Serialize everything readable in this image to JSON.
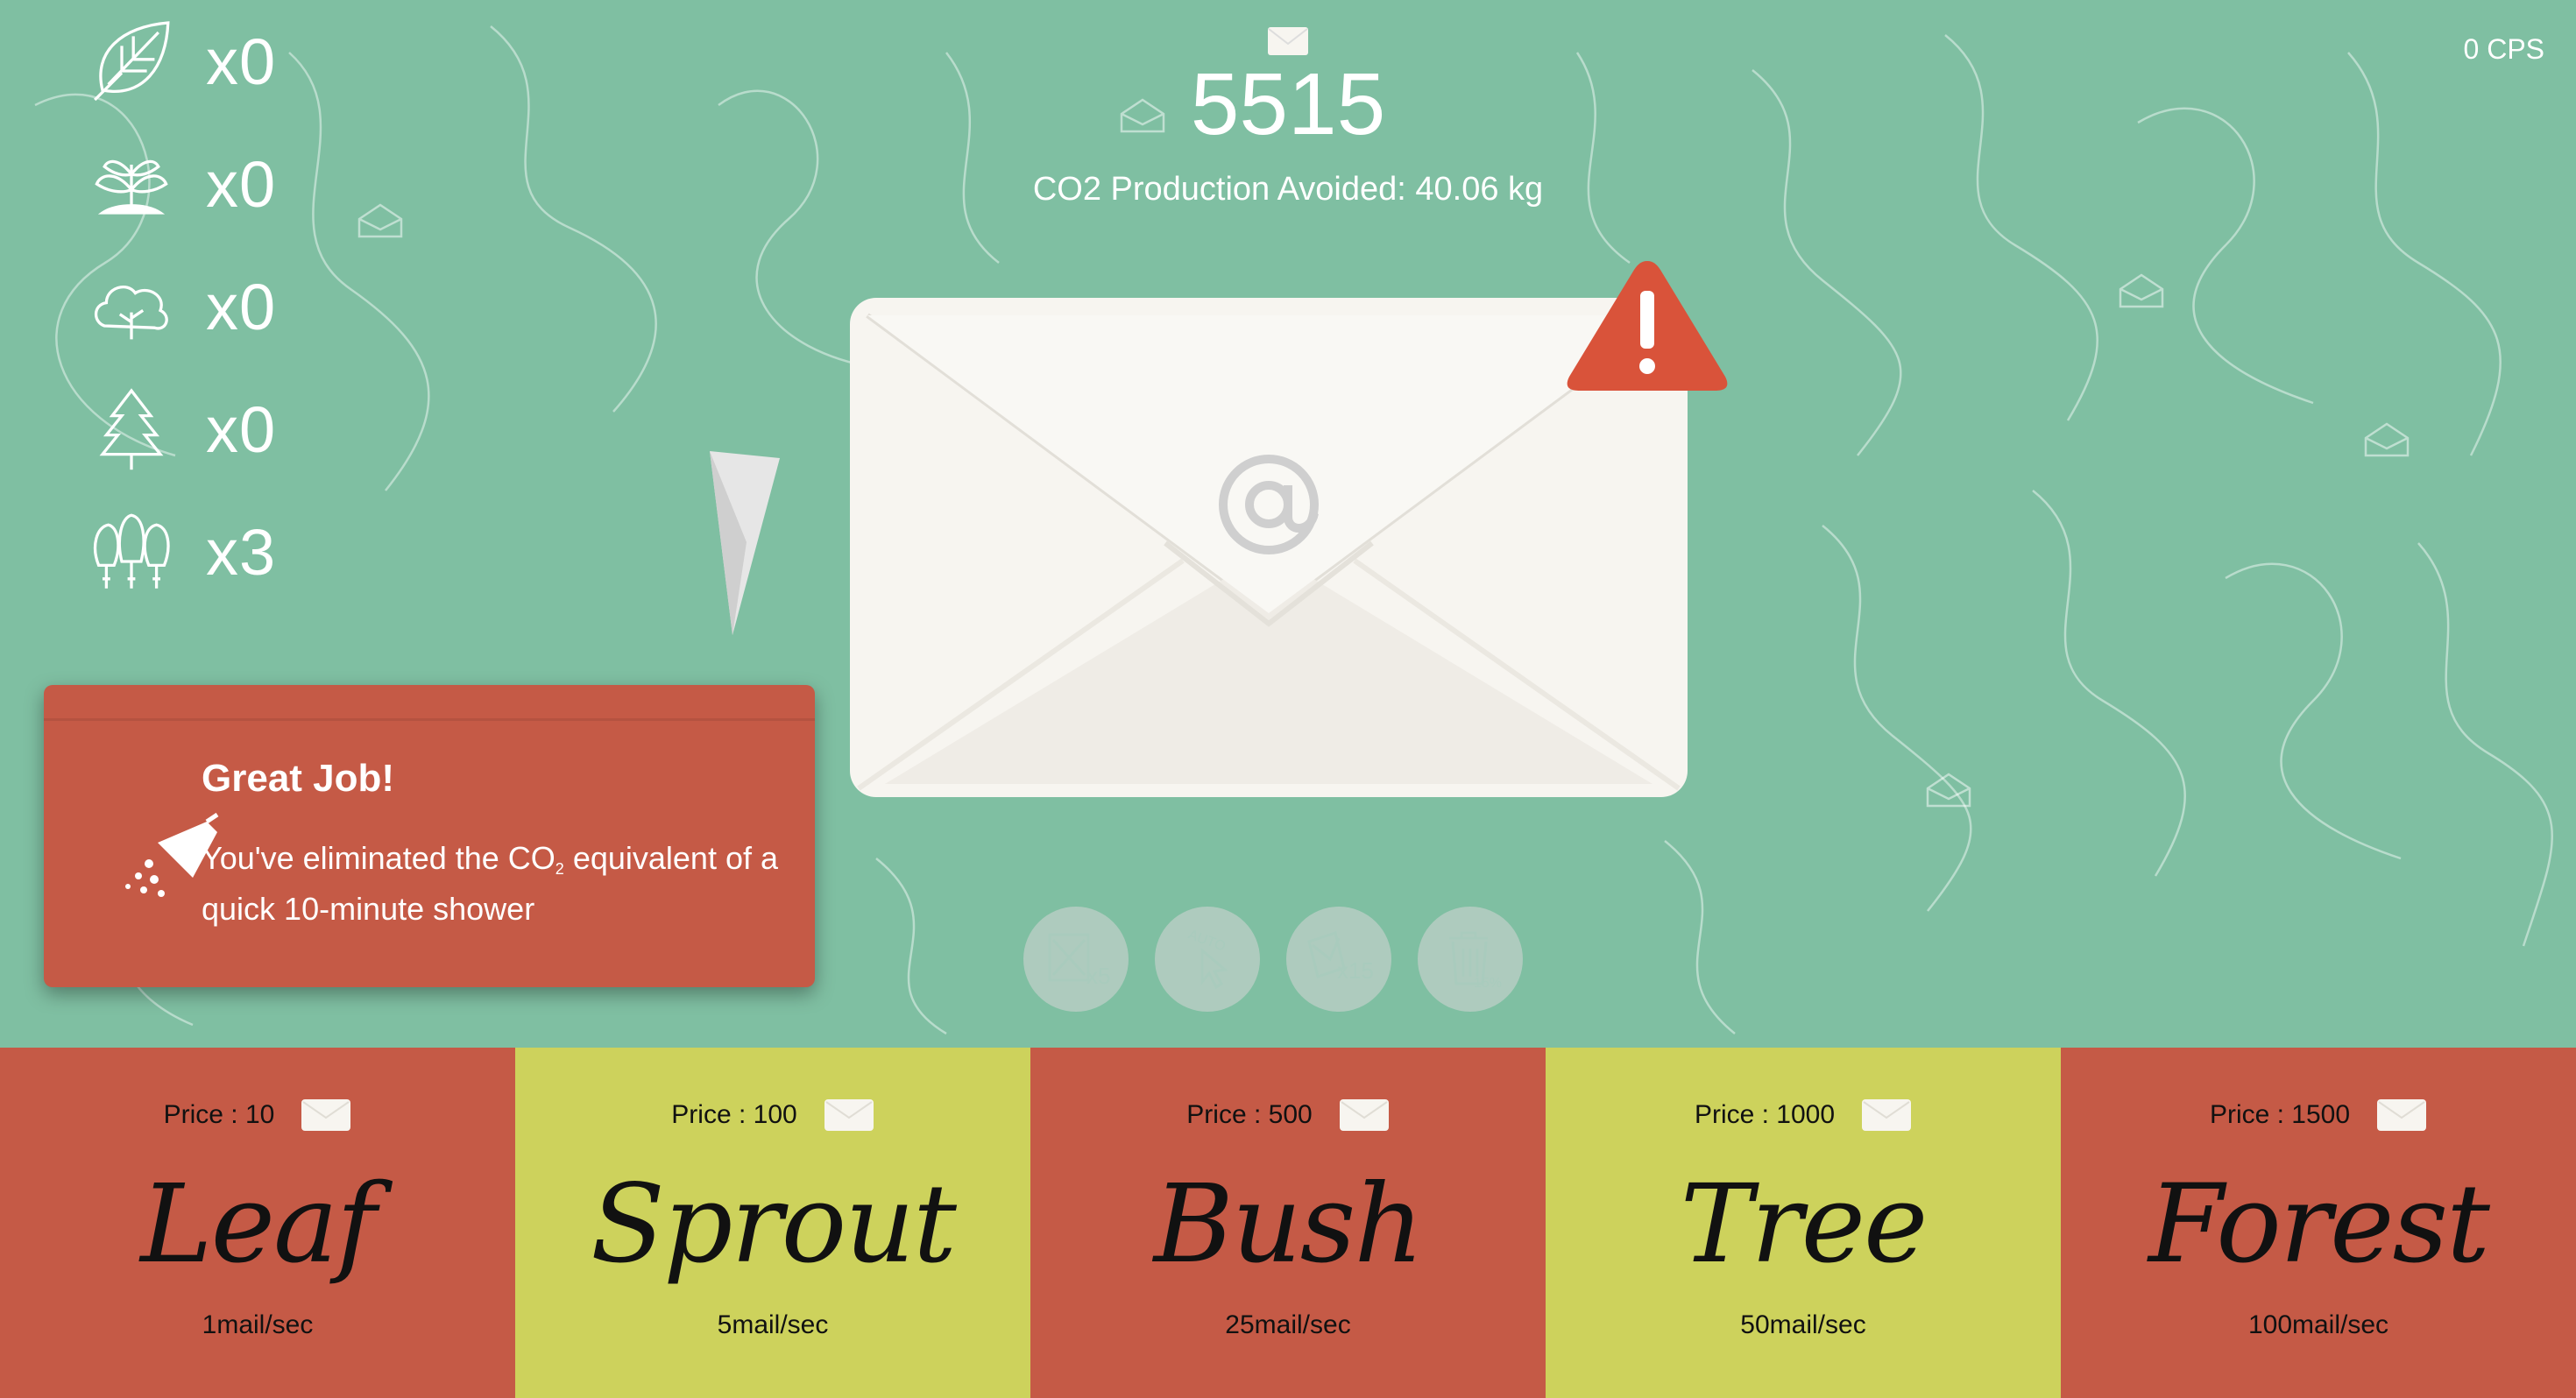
{
  "app": {
    "mail_count": "5515",
    "co2_text": "CO2 Production Avoided: 40.06 kg",
    "cps": "0 CPS"
  },
  "inventory": [
    {
      "name": "Leaf",
      "icon": "leaf-icon",
      "count": "x0"
    },
    {
      "name": "Sprout",
      "icon": "sprout-icon",
      "count": "x0"
    },
    {
      "name": "Bush",
      "icon": "bush-icon",
      "count": "x0"
    },
    {
      "name": "Tree",
      "icon": "tree-icon",
      "count": "x0"
    },
    {
      "name": "Forest",
      "icon": "forest-icon",
      "count": "x3"
    }
  ],
  "powerups": [
    {
      "icon": "delete-x5-icon",
      "label": "x5"
    },
    {
      "icon": "auto-click-icon",
      "label": "AUTO"
    },
    {
      "icon": "mail-x15-icon",
      "label": "x15"
    },
    {
      "icon": "trash-15-percent-icon",
      "label": "15%"
    }
  ],
  "toast": {
    "title": "Great Job!",
    "message_before": "You've eliminated the CO",
    "message_sub": "2",
    "message_after": " equivalent of a quick 10-minute shower",
    "icon": "shower-icon"
  },
  "shop": [
    {
      "price": "Price : 10",
      "name": "Leaf",
      "rate": "1mail/sec",
      "color": "#c55a46"
    },
    {
      "price": "Price : 100",
      "name": "Sprout",
      "rate": "5mail/sec",
      "color": "#cdd25c"
    },
    {
      "price": "Price : 500",
      "name": "Bush",
      "rate": "25mail/sec",
      "color": "#c55a46"
    },
    {
      "price": "Price : 1000",
      "name": "Tree",
      "rate": "50mail/sec",
      "color": "#cdd25c"
    },
    {
      "price": "Price : 1500",
      "name": "Forest",
      "rate": "100mail/sec",
      "color": "#c55a46"
    }
  ],
  "colors": {
    "background": "#7fbfa2",
    "red": "#c55a46",
    "lime": "#cdd25c",
    "alert": "#d9533a",
    "envelope": "#f7f5f0"
  }
}
